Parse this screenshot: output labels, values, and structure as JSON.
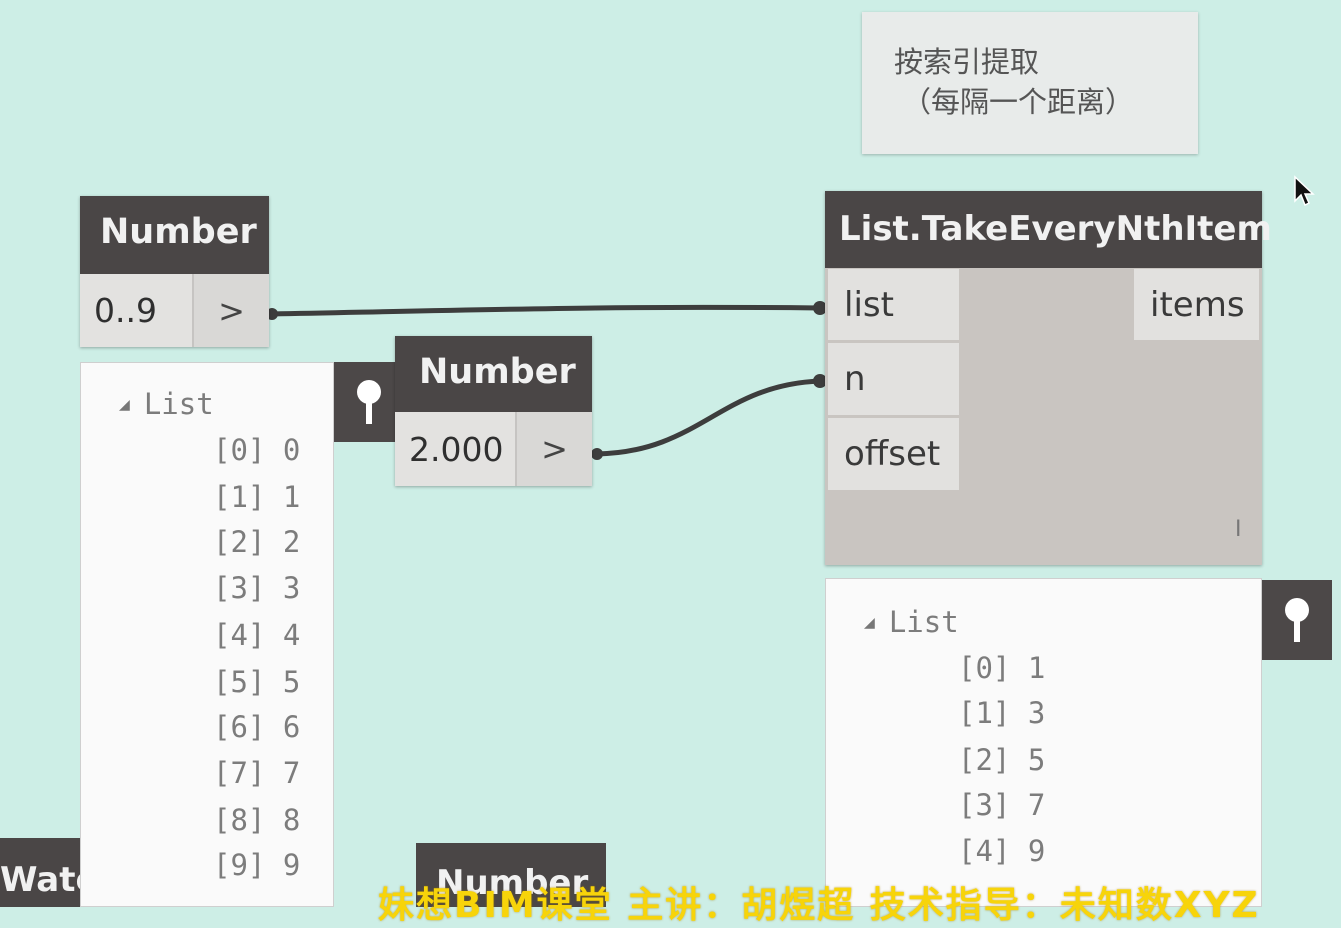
{
  "note": {
    "line1": "按索引提取",
    "line2": "（每隔一个距离）"
  },
  "number_node_1": {
    "title": "Number",
    "value": "0..9",
    "button": ">"
  },
  "number_node_2": {
    "title": "Number",
    "value": "2.000",
    "button": ">"
  },
  "take_node": {
    "title": "List.TakeEveryNthItem",
    "inputs": [
      "list",
      "n",
      "offset"
    ],
    "output": "items",
    "level_mark": "I"
  },
  "watch_left": {
    "header": "List",
    "rows": [
      "[0] 0",
      "[1] 1",
      "[2] 2",
      "[3] 3",
      "[4] 4",
      "[5] 5",
      "[6] 6",
      "[7] 7",
      "[8] 8",
      "[9] 9"
    ]
  },
  "watch_right": {
    "header": "List",
    "rows": [
      "[0] 1",
      "[1] 3",
      "[2] 5",
      "[3] 7",
      "[4] 9"
    ]
  },
  "partial_nodes": {
    "watch_title": "Watc",
    "number_title": "Number"
  },
  "banner": "妹想BIM课堂 主讲：胡煜超 技术指导：未知数XYZ",
  "colors": {
    "canvas": "#cdeee6",
    "node_header": "#4a4646",
    "wire": "#3d3d3d",
    "banner": "#f7d40a"
  },
  "icons": [
    "pin-icon",
    "expand-triangle-icon",
    "mouse-cursor-icon"
  ]
}
